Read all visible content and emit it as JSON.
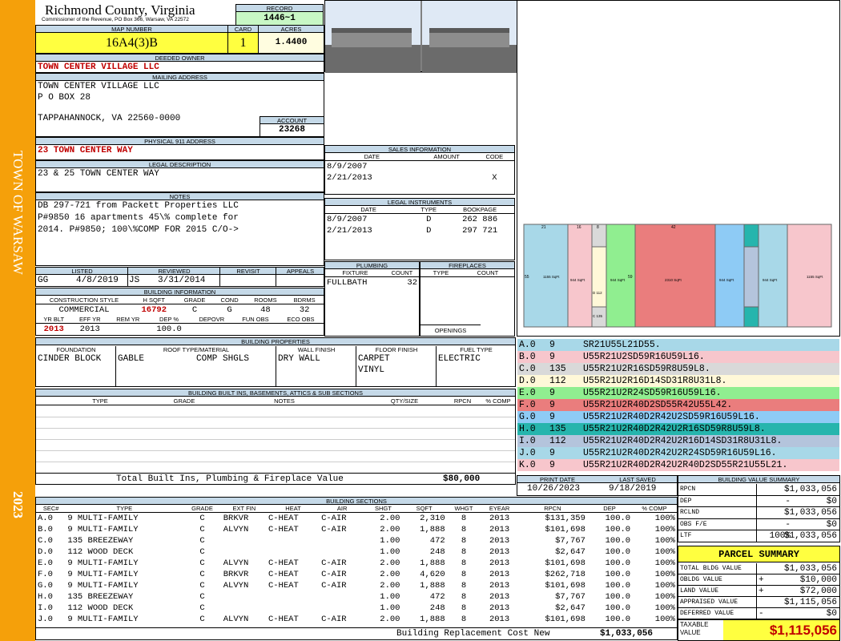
{
  "header": {
    "county": "Richmond County, Virginia",
    "commissioner": "Commissioner of the Revenue, PO Box 366, Warsaw, VA 22572",
    "record_label": "RECORD",
    "record": "1446~1",
    "map_label": "MAP NUMBER",
    "map": "16A4(3)B",
    "card_label": "CARD",
    "card": "1",
    "acres_label": "ACRES",
    "acres": "1.4400"
  },
  "sidebar": {
    "town": "TOWN OF WARSAW",
    "year": "2023"
  },
  "owner": {
    "label": "DEEDED OWNER",
    "name": "TOWN CENTER VILLAGE LLC",
    "mail_label": "MAILING ADDRESS",
    "mail1": "TOWN CENTER VILLAGE LLC",
    "mail2": "P O BOX 28",
    "mail3": "TAPPAHANNOCK, VA 22560-0000",
    "acct_label": "ACCOUNT",
    "acct": "23268",
    "phys_label": "PHYSICAL 911 ADDRESS",
    "phys": "23 TOWN CENTER WAY",
    "legal_label": "LEGAL DESCRIPTION",
    "legal": "23 & 25 TOWN CENTER WAY",
    "notes_label": "NOTES",
    "notes1": "DB 297-721 from Packett Properties LLC",
    "notes2": "P#9850 16 apartments 45\\% complete for",
    "notes3": "2014. P#9850; 100\\%COMP FOR 2015 C/O->"
  },
  "review": {
    "h_listed": "LISTED",
    "h_reviewed": "REVIEWED",
    "h_revisit": "REVISIT",
    "h_appeals": "APPEALS",
    "listed_by": "GG",
    "listed": "4/8/2019",
    "rev_by": "JS",
    "reviewed": "3/31/2014"
  },
  "bldg": {
    "label": "BUILDING INFORMATION",
    "h": [
      "CONSTRUCTION STYLE",
      "H SQFT",
      "GRADE",
      "COND",
      "ROOMS",
      "BDRMS"
    ],
    "v": [
      "COMMERCIAL",
      "16792",
      "C",
      "G",
      "48",
      "32"
    ],
    "h2": [
      "YR BLT",
      "EFF YR",
      "REM YR",
      "DEP %",
      "DEPOVR",
      "FUN OBS",
      "ECO OBS"
    ],
    "v2": [
      "2013",
      "2013",
      "",
      "100.0",
      "",
      "",
      ""
    ]
  },
  "sales": {
    "label": "SALES INFORMATION",
    "h": [
      "DATE",
      "AMOUNT",
      "CODE"
    ],
    "rows": [
      [
        "8/9/2007",
        "",
        ""
      ],
      [
        "2/21/2013",
        "",
        "X"
      ]
    ]
  },
  "legal_inst": {
    "label": "LEGAL INSTRUMENTS",
    "h": [
      "DATE",
      "TYPE",
      "BOOKPAGE"
    ],
    "rows": [
      [
        "8/9/2007",
        "D",
        "262 886"
      ],
      [
        "2/21/2013",
        "D",
        "297 721"
      ]
    ]
  },
  "plumbing": {
    "label": "PLUMBING",
    "h": [
      "FIXTURE",
      "COUNT"
    ],
    "rows": [
      [
        "FULLBATH",
        "32"
      ]
    ]
  },
  "fireplaces": {
    "label": "FIREPLACES",
    "h": [
      "TYPE",
      "COUNT"
    ],
    "openings": "OPENINGS"
  },
  "props": {
    "label": "BUILDING PROPERTIES",
    "h": [
      "FOUNDATION",
      "ROOF TYPE/MATERIAL",
      "WALL FINISH",
      "FLOOR FINISH",
      "FUEL TYPE"
    ],
    "foundation": "CINDER BLOCK",
    "roof1": "GABLE",
    "roof2": "COMP SHGLS",
    "wall": "DRY WALL",
    "floor1": "CARPET",
    "floor2": "VINYL",
    "fuel": "ELECTRIC"
  },
  "builtins": {
    "label": "BUILDING BUILT INS, BASEMENTS, ATTICS & SUB SECTIONS",
    "h": [
      "TYPE",
      "GRADE",
      "NOTES",
      "QTY/SIZE",
      "RPCN",
      "% COMP"
    ],
    "total_label": "Total Built Ins, Plumbing & Fireplace Value",
    "total": "$80,000"
  },
  "print": {
    "h_print": "PRINT DATE",
    "h_saved": "LAST SAVED",
    "print": "10/26/2023",
    "saved": "9/18/2019"
  },
  "sketch": [
    {
      "a": "A.0",
      "b": "9",
      "c": "SR21U55L21D55.",
      "color": "#a8d8e8"
    },
    {
      "a": "B.0",
      "b": "9",
      "c": "U55R21U2SD59R16U59L16.",
      "color": "#f7c6cc"
    },
    {
      "a": "C.0",
      "b": "135",
      "c": "U55R21U2R16SD59R8U59L8.",
      "color": "#d9d9d9"
    },
    {
      "a": "D.0",
      "b": "112",
      "c": "U55R21U2R16D14SD31R8U31L8.",
      "color": "#fff8d8"
    },
    {
      "a": "E.0",
      "b": "9",
      "c": "U55R21U2R24SD59R16U59L16.",
      "color": "#90ee90"
    },
    {
      "a": "F.0",
      "b": "9",
      "c": "U55R21U2R40D2SD55R42U55L42.",
      "color": "#ea7d7d"
    },
    {
      "a": "G.0",
      "b": "9",
      "c": "U55R21U2R40D2R42U2SD59R16U59L16.",
      "color": "#8ecbf5"
    },
    {
      "a": "H.0",
      "b": "135",
      "c": "U55R21U2R40D2R42U2R16SD59R8U59L8.",
      "color": "#26b5ad"
    },
    {
      "a": "I.0",
      "b": "112",
      "c": "U55R21U2R40D2R42U2R16D14SD31R8U31L8.",
      "color": "#b4c4dc"
    },
    {
      "a": "J.0",
      "b": "9",
      "c": "U55R21U2R40D2R42U2R24SD59R16U59L16.",
      "color": "#a8d8e8"
    },
    {
      "a": "K.0",
      "b": "9",
      "c": "U55R21U2R40D2R42U2R40D2SD55R21U55L21.",
      "color": "#f7c6cc"
    }
  ],
  "sketch_labels": {
    "a": "1155 SqFt",
    "b": "944 SqFt",
    "f": "2310 SqFt",
    "x1": "21",
    "x2": "16",
    "x3": "8",
    "x4": "42",
    "x5": "55",
    "x6": "59",
    "x7": "D 112",
    "x8": "C 135"
  },
  "sections": {
    "label": "BUILDING SECTIONS",
    "h": [
      "SEC#",
      "TYPE",
      "GRADE",
      "EXT FIN",
      "HEAT",
      "AIR",
      "SHGT",
      "SQFT",
      "WHGT",
      "EYEAR",
      "RPCN",
      "DEP",
      "% COMP"
    ],
    "rows": [
      [
        "A.0",
        "9 MULTI-FAMILY",
        "C",
        "BRKVR",
        "C-HEAT",
        "C-AIR",
        "2.00",
        "2,310",
        "8",
        "2013",
        "$131,359",
        "100.0",
        "100%"
      ],
      [
        "B.0",
        "9 MULTI-FAMILY",
        "C",
        "ALVYN",
        "C-HEAT",
        "C-AIR",
        "2.00",
        "1,888",
        "8",
        "2013",
        "$101,698",
        "100.0",
        "100%"
      ],
      [
        "C.0",
        "135 BREEZEWAY",
        "C",
        "",
        "",
        "",
        "1.00",
        "472",
        "8",
        "2013",
        "$7,767",
        "100.0",
        "100%"
      ],
      [
        "D.0",
        "112 WOOD DECK",
        "C",
        "",
        "",
        "",
        "1.00",
        "248",
        "8",
        "2013",
        "$2,647",
        "100.0",
        "100%"
      ],
      [
        "E.0",
        "9 MULTI-FAMILY",
        "C",
        "ALVYN",
        "C-HEAT",
        "C-AIR",
        "2.00",
        "1,888",
        "8",
        "2013",
        "$101,698",
        "100.0",
        "100%"
      ],
      [
        "F.0",
        "9 MULTI-FAMILY",
        "C",
        "BRKVR",
        "C-HEAT",
        "C-AIR",
        "2.00",
        "4,620",
        "8",
        "2013",
        "$262,718",
        "100.0",
        "100%"
      ],
      [
        "G.0",
        "9 MULTI-FAMILY",
        "C",
        "ALVYN",
        "C-HEAT",
        "C-AIR",
        "2.00",
        "1,888",
        "8",
        "2013",
        "$101,698",
        "100.0",
        "100%"
      ],
      [
        "H.0",
        "135 BREEZEWAY",
        "C",
        "",
        "",
        "",
        "1.00",
        "472",
        "8",
        "2013",
        "$7,767",
        "100.0",
        "100%"
      ],
      [
        "I.0",
        "112 WOOD DECK",
        "C",
        "",
        "",
        "",
        "1.00",
        "248",
        "8",
        "2013",
        "$2,647",
        "100.0",
        "100%"
      ],
      [
        "J.0",
        "9 MULTI-FAMILY",
        "C",
        "ALVYN",
        "C-HEAT",
        "C-AIR",
        "2.00",
        "1,888",
        "8",
        "2013",
        "$101,698",
        "100.0",
        "100%"
      ]
    ],
    "total_label": "Building Replacement Cost New",
    "total": "$1,033,056"
  },
  "bvs": {
    "label": "BUILDING VALUE SUMMARY",
    "rows": [
      [
        "RPCN",
        "",
        "$1,033,056"
      ],
      [
        "DEP",
        "-",
        "$0"
      ],
      [
        "RCLND",
        "",
        "$1,033,056"
      ],
      [
        "OBS F/E",
        "-",
        "$0"
      ],
      [
        "LTF",
        "100%",
        "$1,033,056"
      ]
    ]
  },
  "parcel": {
    "label": "PARCEL SUMMARY",
    "rows": [
      [
        "TOTAL BLDG VALUE",
        "",
        "$1,033,056"
      ],
      [
        "OBLDG VALUE",
        "+",
        "$10,000"
      ],
      [
        "LAND VALUE",
        "+",
        "$72,000"
      ],
      [
        "APPRAISED VALUE",
        "",
        "$1,115,056"
      ],
      [
        "DEFERRED VALUE",
        "-",
        "$0"
      ]
    ],
    "taxable_label1": "TAXABLE",
    "taxable_label2": "VALUE",
    "taxable": "$1,115,056"
  }
}
